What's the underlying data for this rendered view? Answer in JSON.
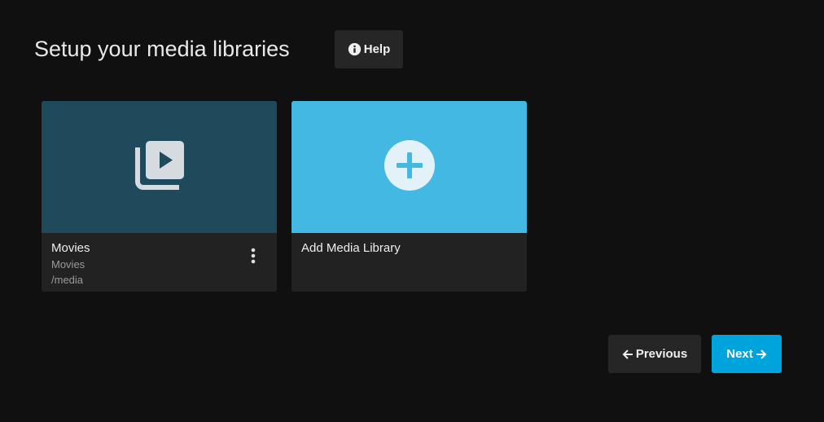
{
  "header": {
    "title": "Setup your media libraries",
    "help_label": "Help"
  },
  "libraries": [
    {
      "title": "Movies",
      "type": "Movies",
      "path": "/media",
      "icon": "video-library-icon"
    }
  ],
  "add_card": {
    "title": "Add Media Library",
    "icon": "add-circle-icon"
  },
  "footer": {
    "previous_label": "Previous",
    "next_label": "Next"
  },
  "colors": {
    "background": "#101010",
    "accent": "#00a4dc",
    "movies_tile": "#1e4a5c",
    "add_tile": "#42b8e2",
    "card": "#222222"
  }
}
